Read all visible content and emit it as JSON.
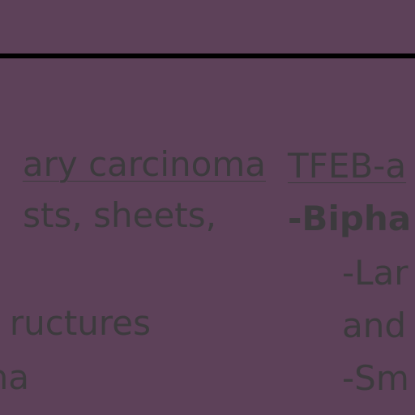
{
  "left_column": {
    "heading": "ary carcinoma",
    "lines": [
      "sts, sheets,",
      "ructures",
      "na"
    ]
  },
  "right_column": {
    "heading": "TFEB-a",
    "lines": [
      "-Bipha",
      "-Lar",
      "and",
      "-Sm"
    ]
  }
}
